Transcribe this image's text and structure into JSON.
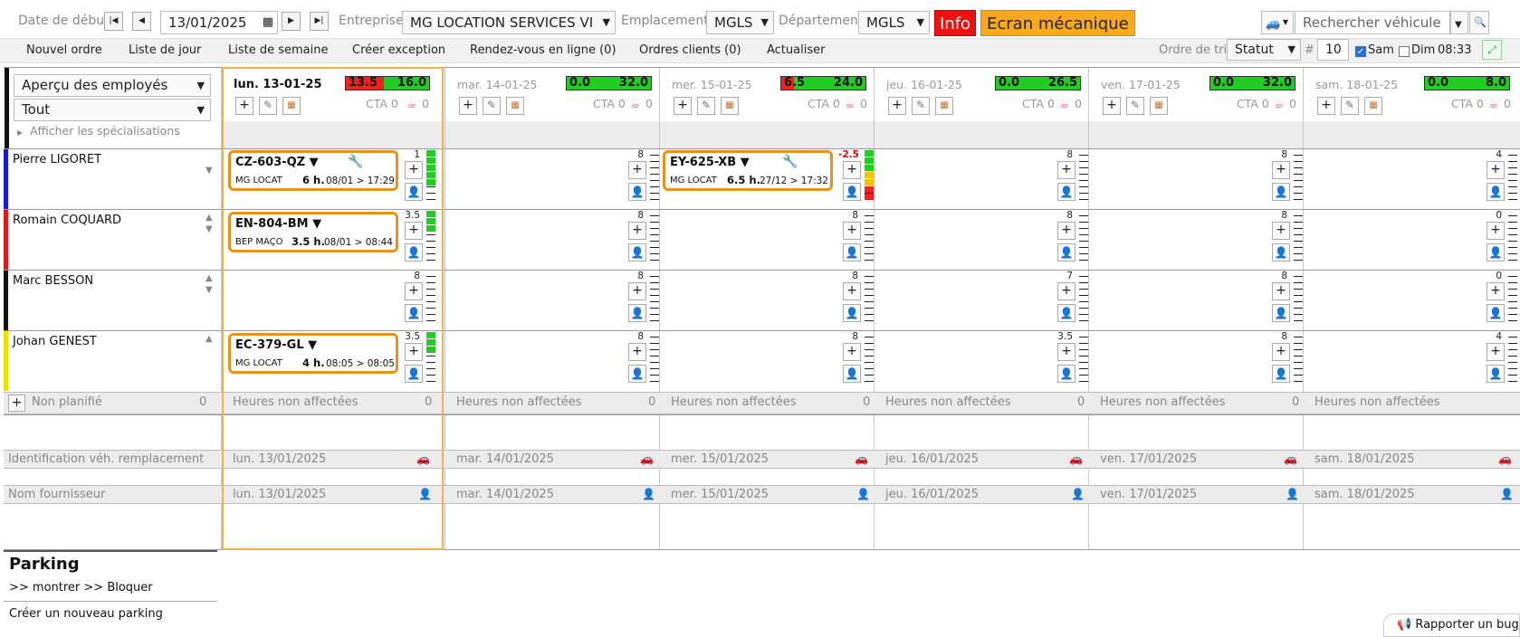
{
  "toolbar": {
    "start_date_label": "Date de début",
    "start_date_value": "13/01/2025",
    "company_label": "Entreprise",
    "company_value": "MG LOCATION SERVICES VI",
    "location_label": "Emplacement",
    "location_value": "MGLS",
    "department_label": "Département",
    "department_value": "MGLS",
    "info_label": "Info",
    "mechanic_screen_label": "Ecran mécanique",
    "vehicle_search_placeholder": "Rechercher véhicule"
  },
  "menu": {
    "items": [
      "Nouvel ordre",
      "Liste de jour",
      "Liste de semaine",
      "Créer exception",
      "Rendez-vous en ligne (0)",
      "Ordres clients (0)",
      "Actualiser"
    ],
    "sort_label": "Ordre de tri",
    "sort_value": "Statut",
    "hash": "#",
    "count_value": "10",
    "sat_label": "Sam",
    "sun_label": "Dim",
    "time": "08:33"
  },
  "side": {
    "view_select": "Aperçu des employés",
    "filter_select": "Tout",
    "specialisations": "Afficher les spécialisations"
  },
  "days": [
    {
      "name": "lun. 13-01-25",
      "left_val": "13.5",
      "right_val": "16.0",
      "cta": "CTA 0",
      "cups": "0"
    },
    {
      "name": "mar. 14-01-25",
      "left_val": "0.0",
      "right_val": "32.0",
      "cta": "CTA 0",
      "cups": "0"
    },
    {
      "name": "mer. 15-01-25",
      "left_val": "6.5",
      "right_val": "24.0",
      "cta": "CTA 0",
      "cups": "0"
    },
    {
      "name": "jeu. 16-01-25",
      "left_val": "0.0",
      "right_val": "26.5",
      "cta": "CTA 0",
      "cups": "0"
    },
    {
      "name": "ven. 17-01-25",
      "left_val": "0.0",
      "right_val": "32.0",
      "cta": "CTA 0",
      "cups": "0"
    },
    {
      "name": "sam. 18-01-25",
      "left_val": "0.0",
      "right_val": "8.0",
      "cta": "CTA 0",
      "cups": "0"
    }
  ],
  "employees": [
    {
      "name": "Pierre LIGORET",
      "color": "#1a1add",
      "counts": [
        "1",
        "8",
        "-2.5",
        "8",
        "8",
        "4"
      ]
    },
    {
      "name": "Romain COQUARD",
      "color": "#e01b1b",
      "counts": [
        "3.5",
        "8",
        "8",
        "8",
        "8",
        "0"
      ]
    },
    {
      "name": "Marc BESSON",
      "color": "#111111",
      "counts": [
        "8",
        "8",
        "8",
        "7",
        "8",
        "0"
      ]
    },
    {
      "name": "Johan GENEST",
      "color": "#f0e000",
      "counts": [
        "3.5",
        "8",
        "8",
        "3.5",
        "8",
        "4"
      ]
    }
  ],
  "orders": [
    {
      "plate": "CZ-603-QZ",
      "client": "MG LOCAT",
      "hours": "6 h.",
      "range": "08/01 > 17:29"
    },
    {
      "plate": "EY-625-XB",
      "client": "MG LOCAT",
      "hours": "6.5 h.",
      "range": "27/12 > 17:32"
    },
    {
      "plate": "EN-804-BM",
      "client": "BEP MAÇO",
      "hours": "3.5 h.",
      "range": "08/01 > 08:44"
    },
    {
      "plate": "EC-379-GL",
      "client": "MG LOCAT",
      "hours": "4 h.",
      "range": "08:05 > 08:05"
    }
  ],
  "unplanned": {
    "label": "Non planifié",
    "count": "0",
    "unassigned_label": "Heures non affectées",
    "unassigned_counts": [
      "0",
      "0",
      "0",
      "0",
      "0",
      ""
    ]
  },
  "replacement": {
    "label": "Identification véh. remplacement",
    "dates": [
      "lun. 13/01/2025",
      "mar. 14/01/2025",
      "mer. 15/01/2025",
      "jeu. 16/01/2025",
      "ven. 17/01/2025",
      "sam. 18/01/2025"
    ]
  },
  "supplier": {
    "label": "Nom fournisseur",
    "dates": [
      "lun. 13/01/2025",
      "mar. 14/01/2025",
      "mer. 15/01/2025",
      "jeu. 16/01/2025",
      "ven. 17/01/2025",
      "sam. 18/01/2025"
    ]
  },
  "parking": {
    "title": "Parking",
    "links": ">> montrer >> Bloquer",
    "new": "Créer un nouveau parking"
  },
  "report_bug": "Rapporter un bug",
  "colors": {
    "accent_orange": "#e8921e",
    "info_red": "#ee1111",
    "ok_green": "#22cc22"
  }
}
